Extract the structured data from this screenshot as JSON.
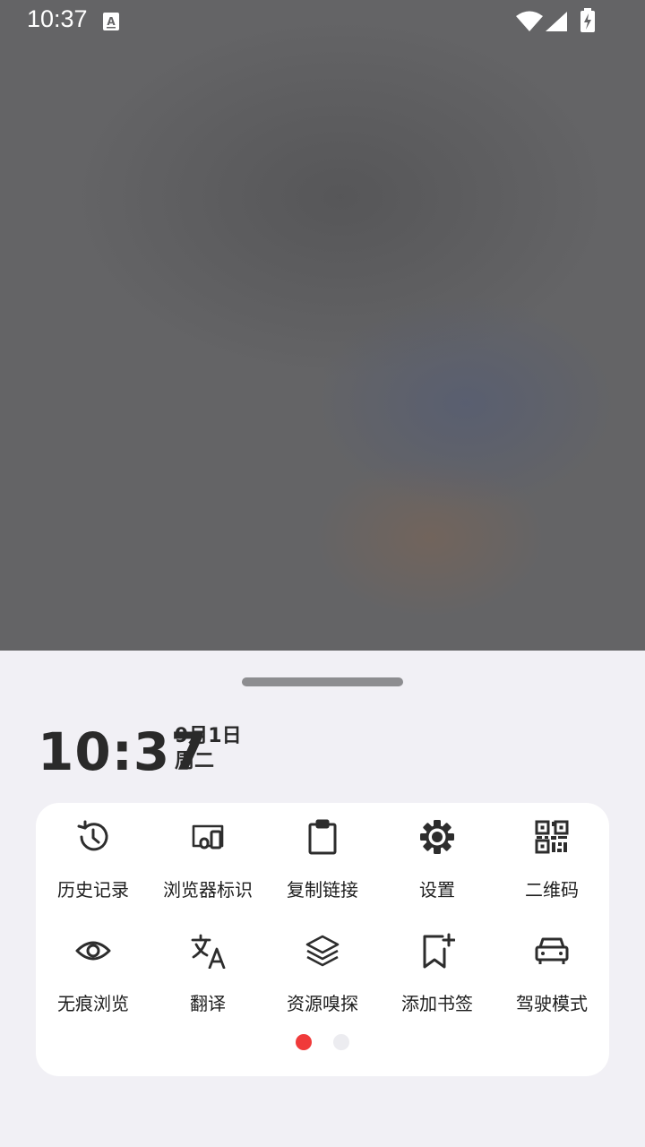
{
  "status_bar": {
    "time": "10:37",
    "notification_icon": "a-icon",
    "wifi_icon": "wifi-icon",
    "signal_icon": "signal-icon",
    "battery_icon": "battery-charging-icon"
  },
  "clock": {
    "time": "10:37",
    "date": "9月1日",
    "weekday": "周二"
  },
  "menu": {
    "pages": 2,
    "current_page": 1,
    "items": [
      {
        "label": "历史记录",
        "icon": "history-icon"
      },
      {
        "label": "浏览器标识",
        "icon": "devices-icon"
      },
      {
        "label": "复制链接",
        "icon": "clipboard-icon"
      },
      {
        "label": "设置",
        "icon": "gear-icon"
      },
      {
        "label": "二维码",
        "icon": "qrcode-icon"
      },
      {
        "label": "无痕浏览",
        "icon": "eye-icon"
      },
      {
        "label": "翻译",
        "icon": "translate-icon"
      },
      {
        "label": "资源嗅探",
        "icon": "layers-icon"
      },
      {
        "label": "添加书签",
        "icon": "bookmark-add-icon"
      },
      {
        "label": "驾驶模式",
        "icon": "car-icon"
      }
    ]
  },
  "colors": {
    "active_dot": "#f03a3a",
    "inactive_dot": "#ececf0",
    "icon": "#2d2d2d"
  }
}
